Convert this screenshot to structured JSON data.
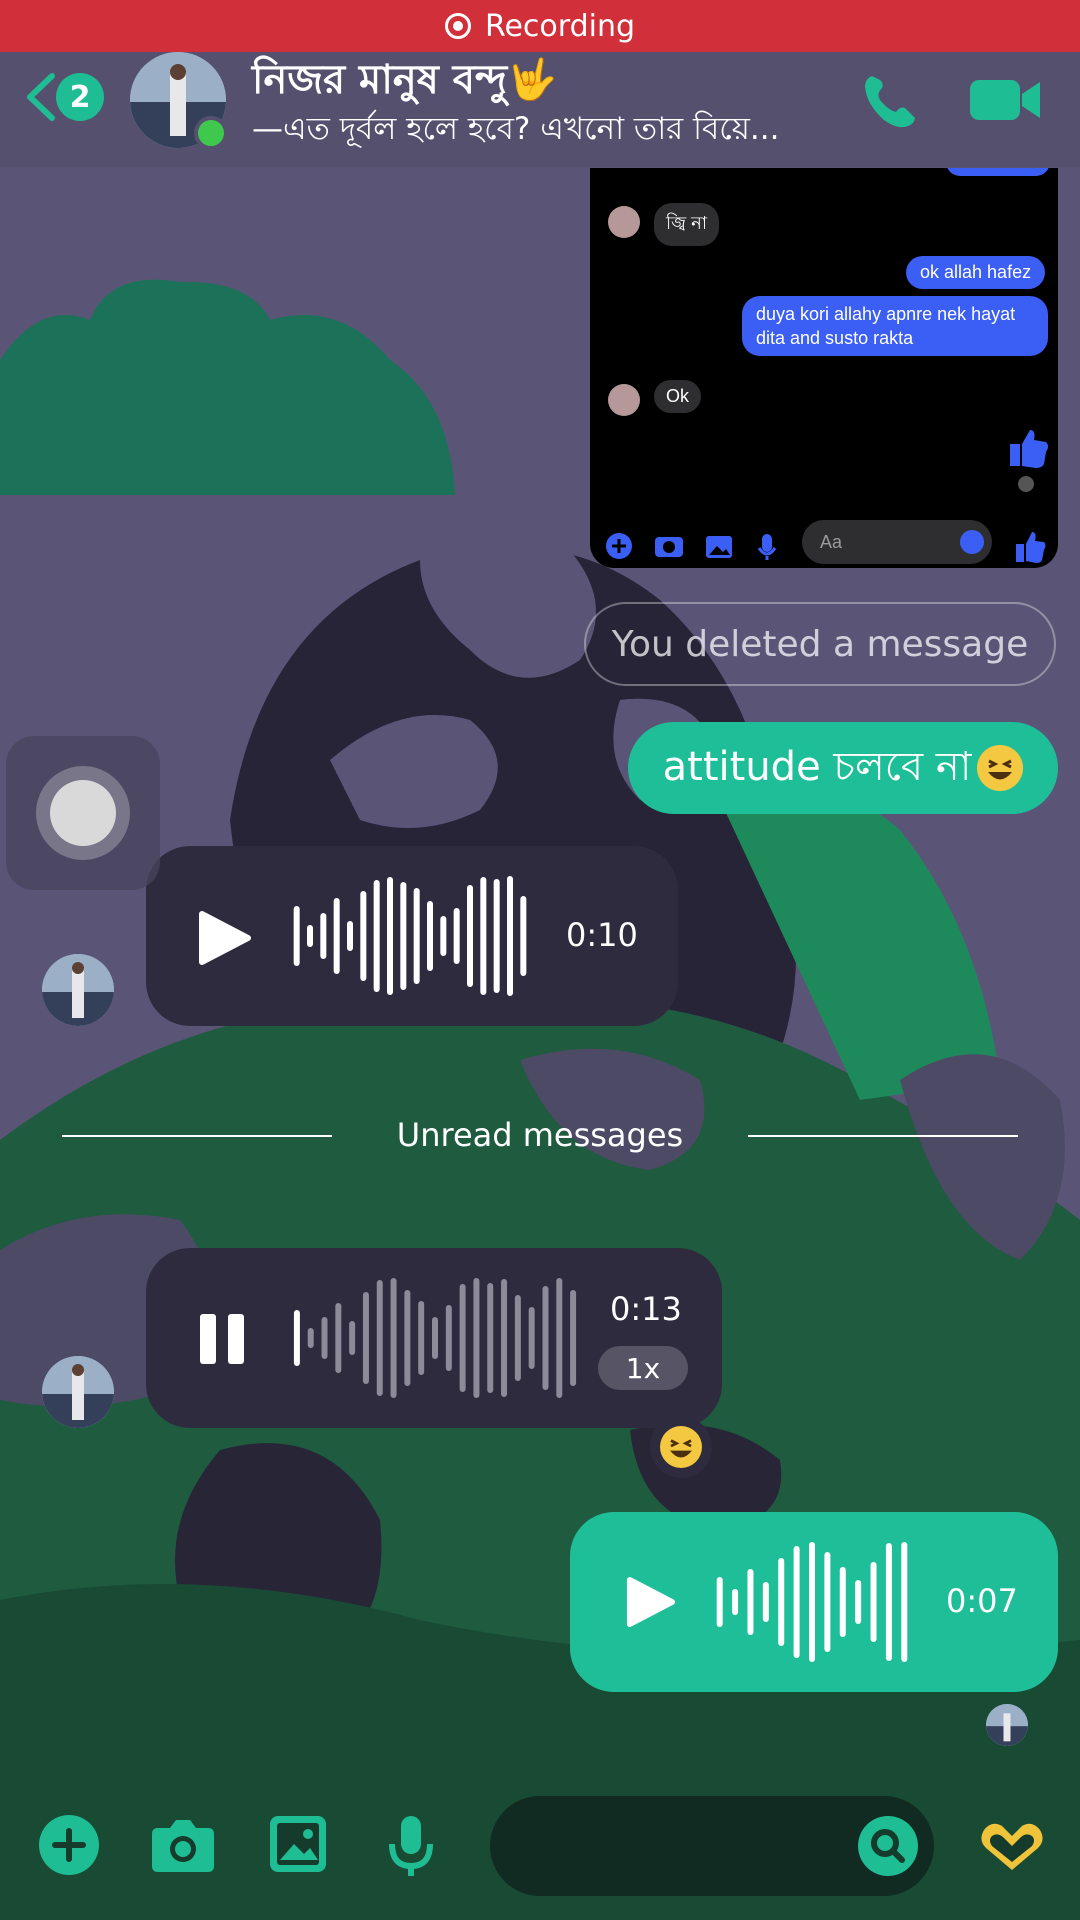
{
  "status_bar": {
    "recording_label": "Recording"
  },
  "header": {
    "unread_count": "2",
    "title": "নিজর মানুষ বন্দু🤟",
    "subtitle": "—এত দূর্বল হলে হবে? এখনো তার বিয়ে...",
    "online": true
  },
  "embedded_screenshot": {
    "messages": [
      {
        "from": "them",
        "text": "জ্বি না"
      },
      {
        "from": "me",
        "text": "ok allah hafez"
      },
      {
        "from": "me",
        "text": "duya kori allahy apnre nek hayat dita and susto rakta"
      },
      {
        "from": "them",
        "text": "Ok"
      }
    ],
    "composer_placeholder": "Aa"
  },
  "messages": {
    "deleted_text": "You deleted a message",
    "attitude_text": "attitude চলবে না"
  },
  "voice_messages": [
    {
      "duration": "0:10",
      "state": "paused"
    },
    {
      "duration": "0:13",
      "state": "playing",
      "speed": "1x"
    },
    {
      "duration": "0:07",
      "state": "paused"
    }
  ],
  "divider": {
    "label": "Unread messages"
  },
  "reaction": "😆",
  "colors": {
    "accent": "#1ebf98",
    "recording_bar": "#d1303a",
    "bubble_dark": "#2e2b3f",
    "messenger_blue": "#3b5ff5"
  }
}
